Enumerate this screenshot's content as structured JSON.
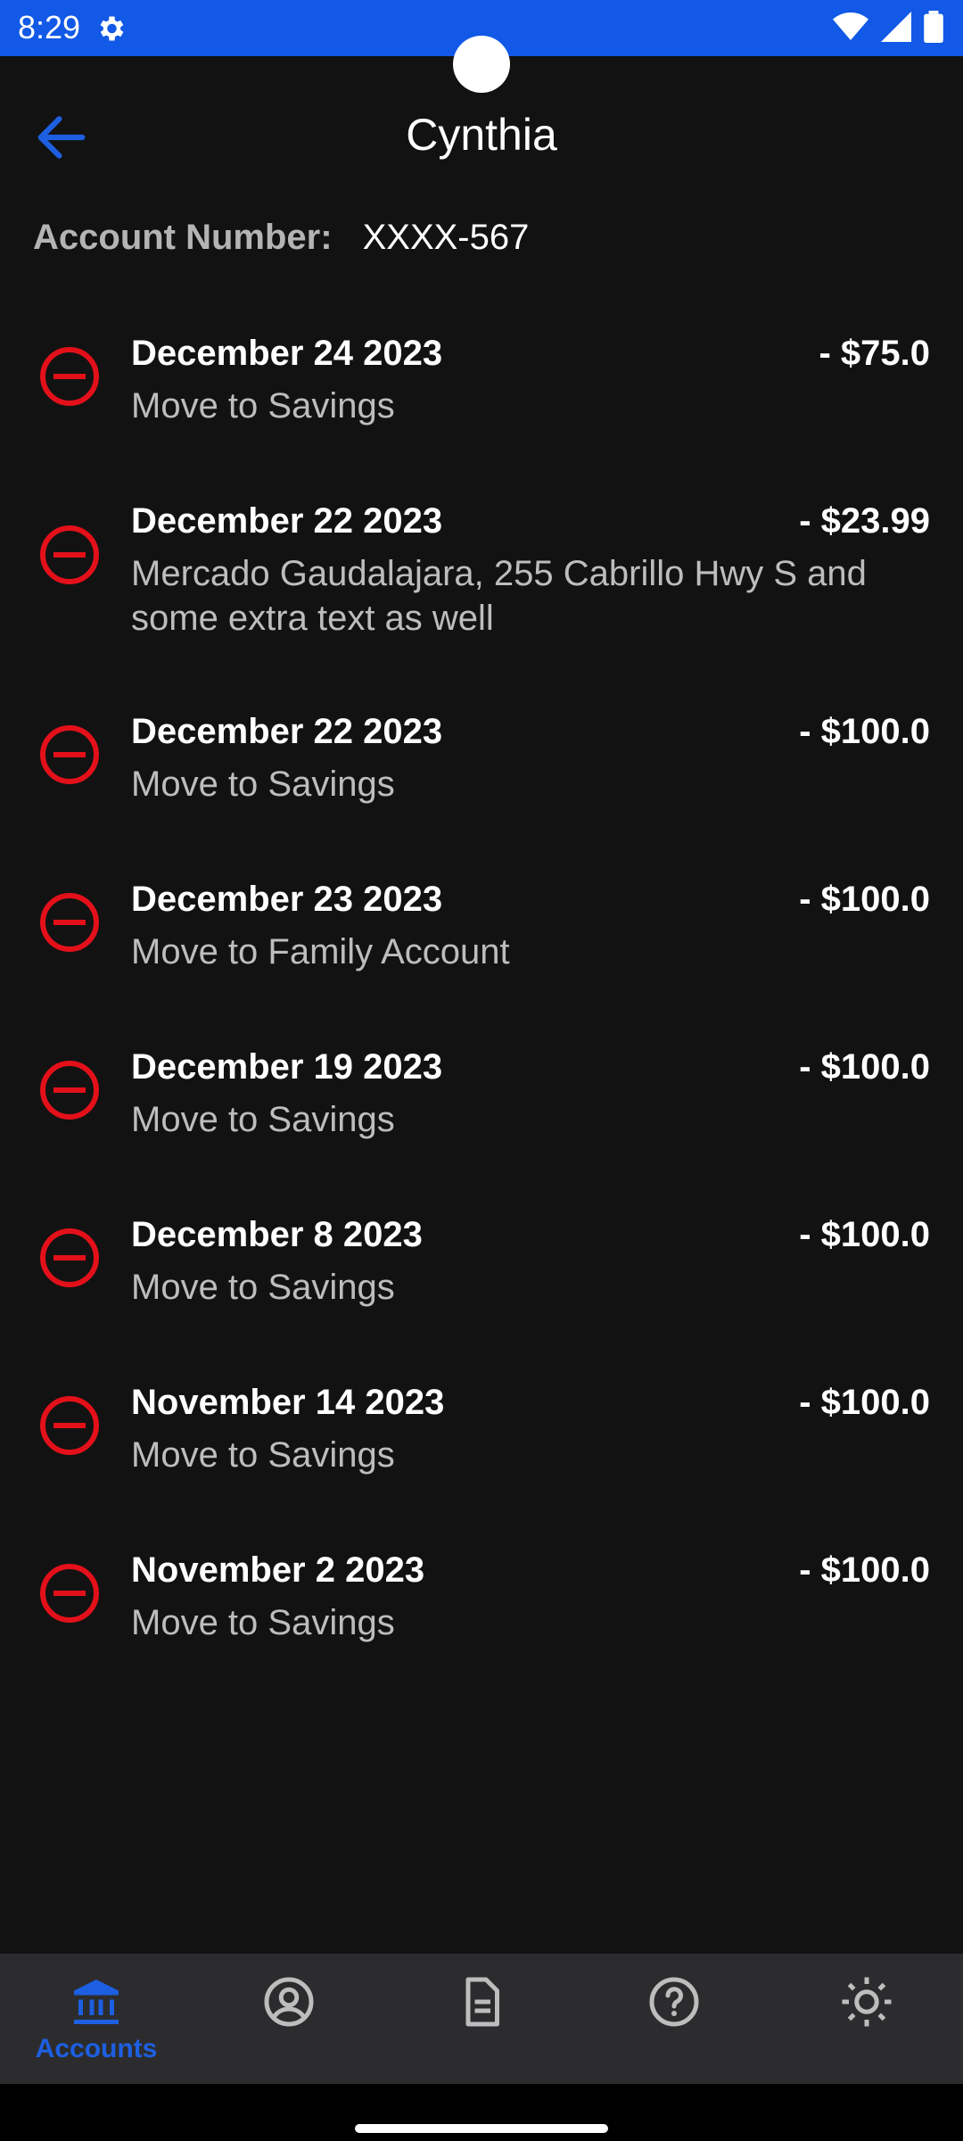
{
  "status": {
    "time": "8:29"
  },
  "header": {
    "title": "Cynthia"
  },
  "account": {
    "label": "Account Number:",
    "value": "XXXX-567"
  },
  "transactions": [
    {
      "date": "December 24 2023",
      "amount": "- $75.0",
      "desc": "Move to Savings"
    },
    {
      "date": "December 22 2023",
      "amount": "- $23.99",
      "desc": "Mercado Gaudalajara, 255 Cabrillo Hwy S and some extra text as well"
    },
    {
      "date": "December 22 2023",
      "amount": "- $100.0",
      "desc": "Move to Savings"
    },
    {
      "date": "December 23 2023",
      "amount": "- $100.0",
      "desc": "Move to Family Account"
    },
    {
      "date": "December 19 2023",
      "amount": "- $100.0",
      "desc": "Move to Savings"
    },
    {
      "date": "December 8 2023",
      "amount": "- $100.0",
      "desc": "Move to Savings"
    },
    {
      "date": "November 14 2023",
      "amount": "- $100.0",
      "desc": "Move to Savings"
    },
    {
      "date": "November 2 2023",
      "amount": "- $100.0",
      "desc": "Move to Savings"
    }
  ],
  "nav": {
    "accounts_label": "Accounts",
    "items": [
      {
        "icon": "bank-icon",
        "label": "Accounts",
        "active": true
      },
      {
        "icon": "profile-icon"
      },
      {
        "icon": "document-icon"
      },
      {
        "icon": "help-icon"
      },
      {
        "icon": "brightness-icon"
      }
    ]
  },
  "colors": {
    "accent": "#1d5fe0",
    "status_bar": "#1159e6",
    "debit_icon": "#e3101a",
    "background": "#121212"
  }
}
